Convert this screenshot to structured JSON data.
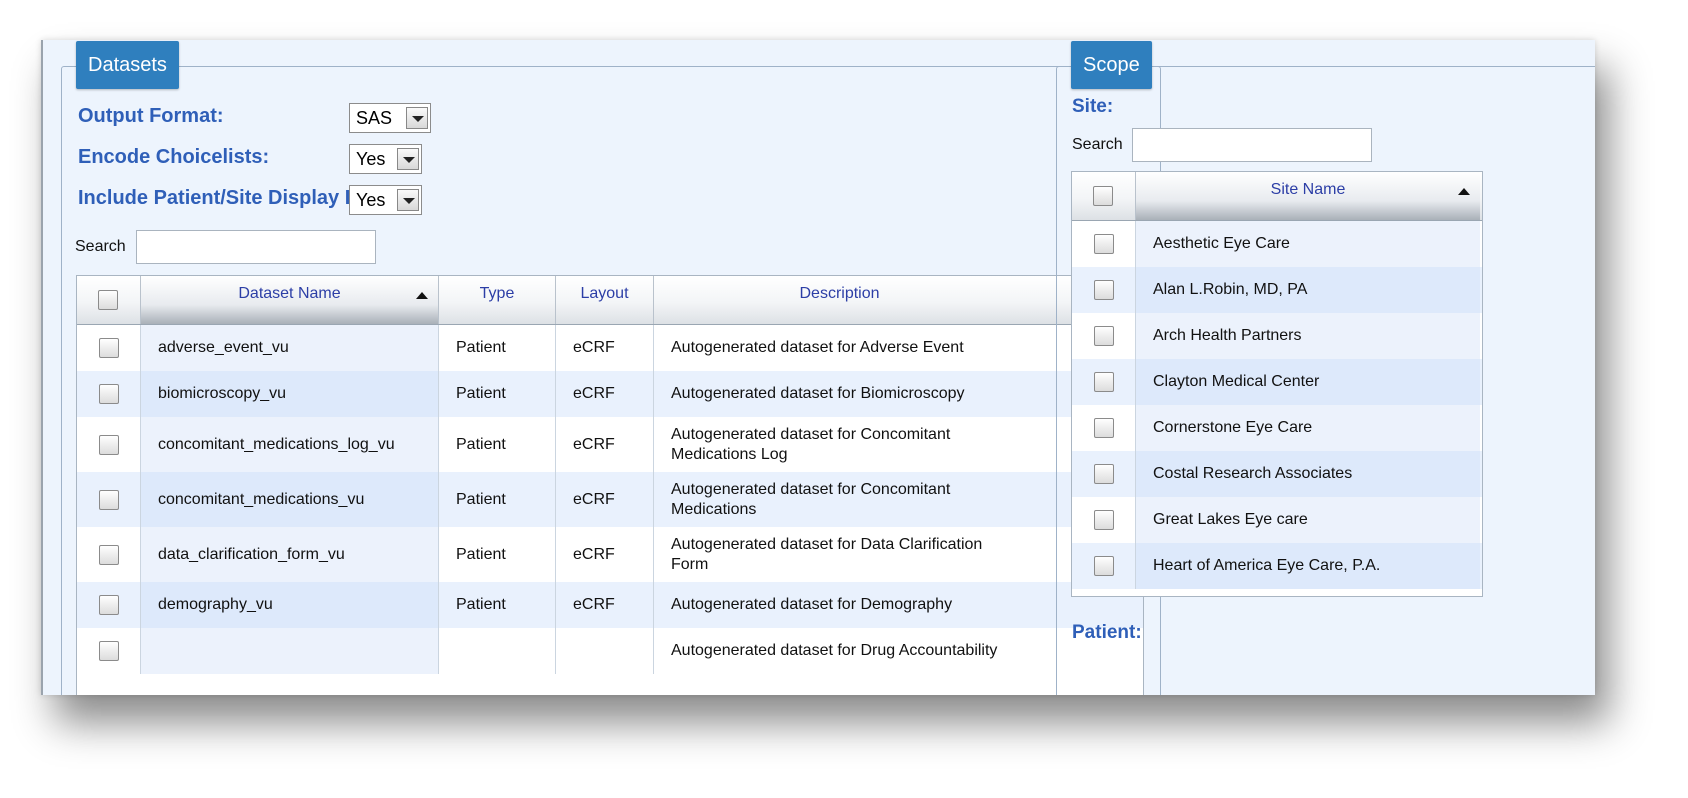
{
  "datasets": {
    "legend": "Datasets",
    "output_format": {
      "label": "Output Format:",
      "value": "SAS"
    },
    "encode_choicelists": {
      "label": "Encode Choicelists:",
      "value": "Yes"
    },
    "include_display_id": {
      "label": "Include Patient/Site Display ID:",
      "value": "Yes"
    },
    "search": {
      "label": "Search",
      "value": ""
    },
    "columns": {
      "name": "Dataset Name",
      "type": "Type",
      "layout": "Layout",
      "description": "Description"
    },
    "rows": [
      {
        "name": "adverse_event_vu",
        "type": "Patient",
        "layout": "eCRF",
        "description": "Autogenerated dataset for Adverse Event"
      },
      {
        "name": "biomicroscopy_vu",
        "type": "Patient",
        "layout": "eCRF",
        "description": "Autogenerated dataset for Biomicroscopy"
      },
      {
        "name": "concomitant_medications_log_vu",
        "type": "Patient",
        "layout": "eCRF",
        "description": "Autogenerated dataset for Concomitant Medications Log"
      },
      {
        "name": "concomitant_medications_vu",
        "type": "Patient",
        "layout": "eCRF",
        "description": "Autogenerated dataset for Concomitant Medications"
      },
      {
        "name": "data_clarification_form_vu",
        "type": "Patient",
        "layout": "eCRF",
        "description": "Autogenerated dataset for Data Clarification Form"
      },
      {
        "name": "demography_vu",
        "type": "Patient",
        "layout": "eCRF",
        "description": "Autogenerated dataset for Demography"
      },
      {
        "name": "",
        "type": "",
        "layout": "",
        "description": "Autogenerated dataset for Drug Accountability"
      }
    ]
  },
  "scope": {
    "legend": "Scope",
    "site_label": "Site:",
    "search": {
      "label": "Search",
      "value": ""
    },
    "site_column": "Site Name",
    "sites": [
      "Aesthetic Eye Care",
      "Alan L.Robin, MD, PA",
      "Arch Health Partners",
      "Clayton Medical Center",
      "Cornerstone Eye Care",
      "Costal Research Associates",
      "Great Lakes Eye care",
      "Heart of America Eye Care, P.A."
    ],
    "patient_label": "Patient:"
  },
  "colors": {
    "legend_bg": "#2f7fbe",
    "label_blue": "#2f5fb8",
    "header_text": "#2c3ea6",
    "panel_bg": "#edf4fd"
  }
}
